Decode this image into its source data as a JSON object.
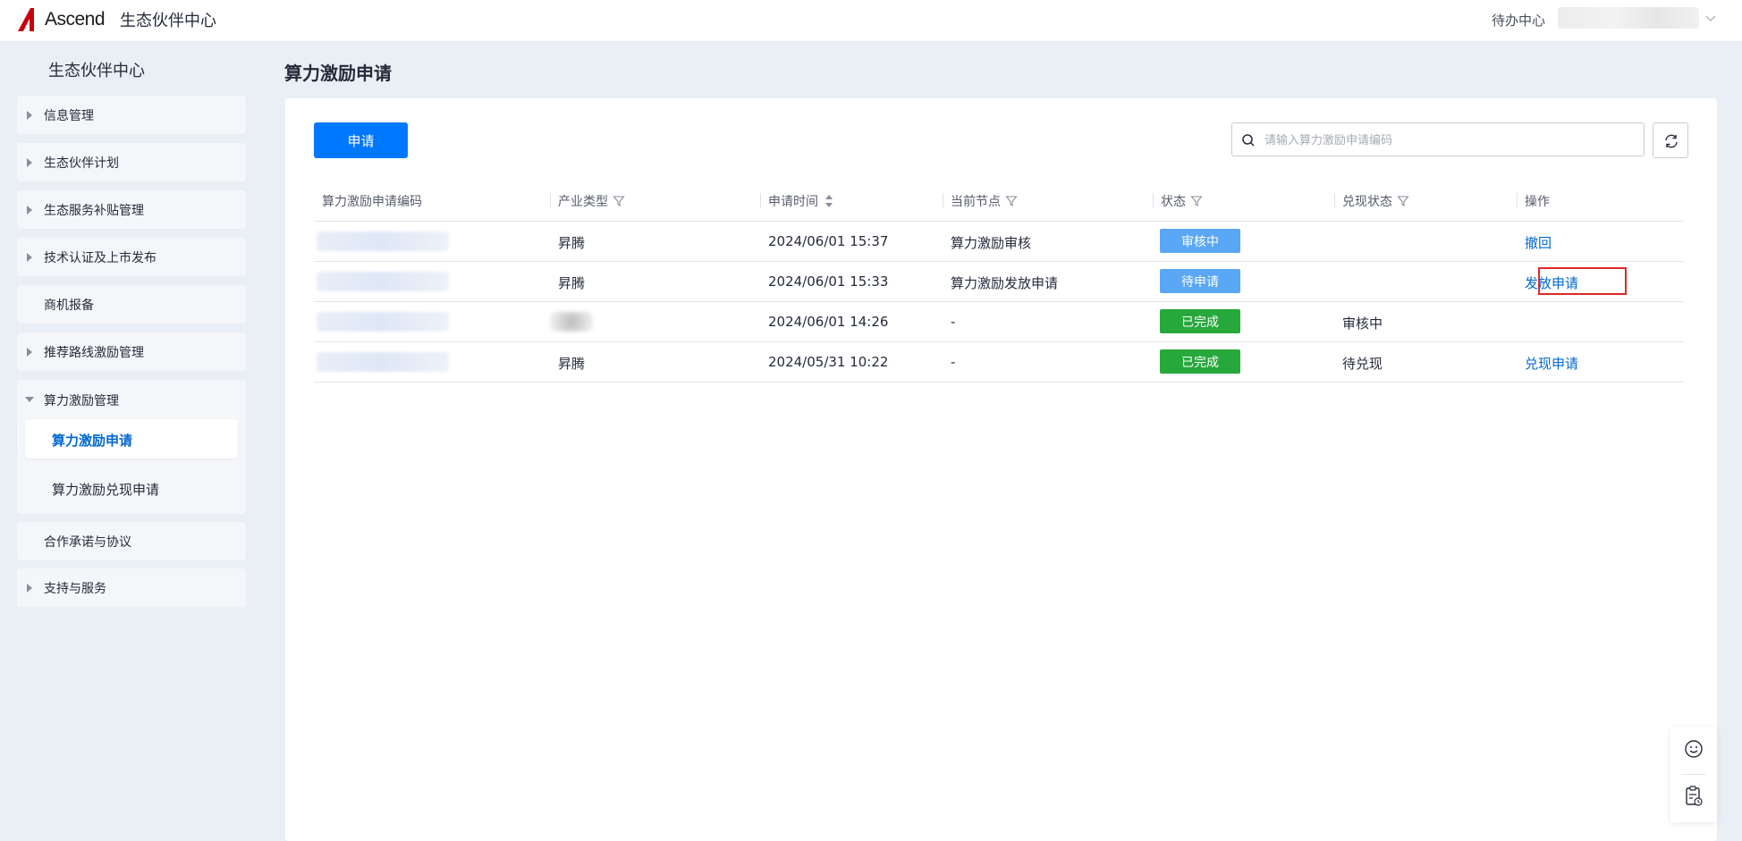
{
  "header": {
    "logo_text": "Ascend",
    "site_title": "生态伙伴中心",
    "todo_label": "待办中心"
  },
  "sidebar": {
    "title": "生态伙伴中心",
    "items": [
      {
        "label": "信息管理",
        "arrow": "right"
      },
      {
        "label": "生态伙伴计划",
        "arrow": "right"
      },
      {
        "label": "生态服务补贴管理",
        "arrow": "right"
      },
      {
        "label": "技术认证及上市发布",
        "arrow": "right"
      },
      {
        "label": "商机报备",
        "arrow": "none"
      },
      {
        "label": "推荐路线激励管理",
        "arrow": "right"
      },
      {
        "label": "算力激励管理",
        "arrow": "down"
      },
      {
        "label": "合作承诺与协议",
        "arrow": "none"
      },
      {
        "label": "支持与服务",
        "arrow": "right"
      }
    ],
    "sub_items": [
      {
        "label": "算力激励申请",
        "active": true
      },
      {
        "label": "算力激励兑现申请",
        "active": false
      }
    ]
  },
  "main": {
    "page_title": "算力激励申请",
    "apply_button": "申请",
    "search": {
      "placeholder": "请输入算力激励申请编码",
      "value": ""
    },
    "table": {
      "columns": [
        "算力激励申请编码",
        "产业类型",
        "申请时间",
        "当前节点",
        "状态",
        "兑现状态",
        "操作"
      ],
      "rows": [
        {
          "code": "",
          "type": "昇腾",
          "time": "2024/06/01 15:37",
          "node": "算力激励审核",
          "status": "审核中",
          "status_color": "#5aa7f5",
          "cash_status": "",
          "action": "撤回"
        },
        {
          "code": "",
          "type": "昇腾",
          "time": "2024/06/01 15:33",
          "node": "算力激励发放申请",
          "status": "待申请",
          "status_color": "#5aa7f5",
          "cash_status": "",
          "action": "发放申请"
        },
        {
          "code": "",
          "type": "",
          "time": "2024/06/01 14:26",
          "node": "-",
          "status": "已完成",
          "status_color": "#27a83b",
          "cash_status": "审核中",
          "action": ""
        },
        {
          "code": "",
          "type": "昇腾",
          "time": "2024/05/31 10:22",
          "node": "-",
          "status": "已完成",
          "status_color": "#27a83b",
          "cash_status": "待兑现",
          "action": "兑现申请"
        }
      ]
    }
  },
  "colors": {
    "primary": "#0077ff",
    "link": "#0067d1",
    "highlight": "#e02828",
    "background": "#eaeef5"
  },
  "icons": [
    "search-icon",
    "refresh-icon",
    "filter-icon",
    "sort-icon",
    "smile-icon",
    "clipboard-icon",
    "chevron-down-icon"
  ]
}
